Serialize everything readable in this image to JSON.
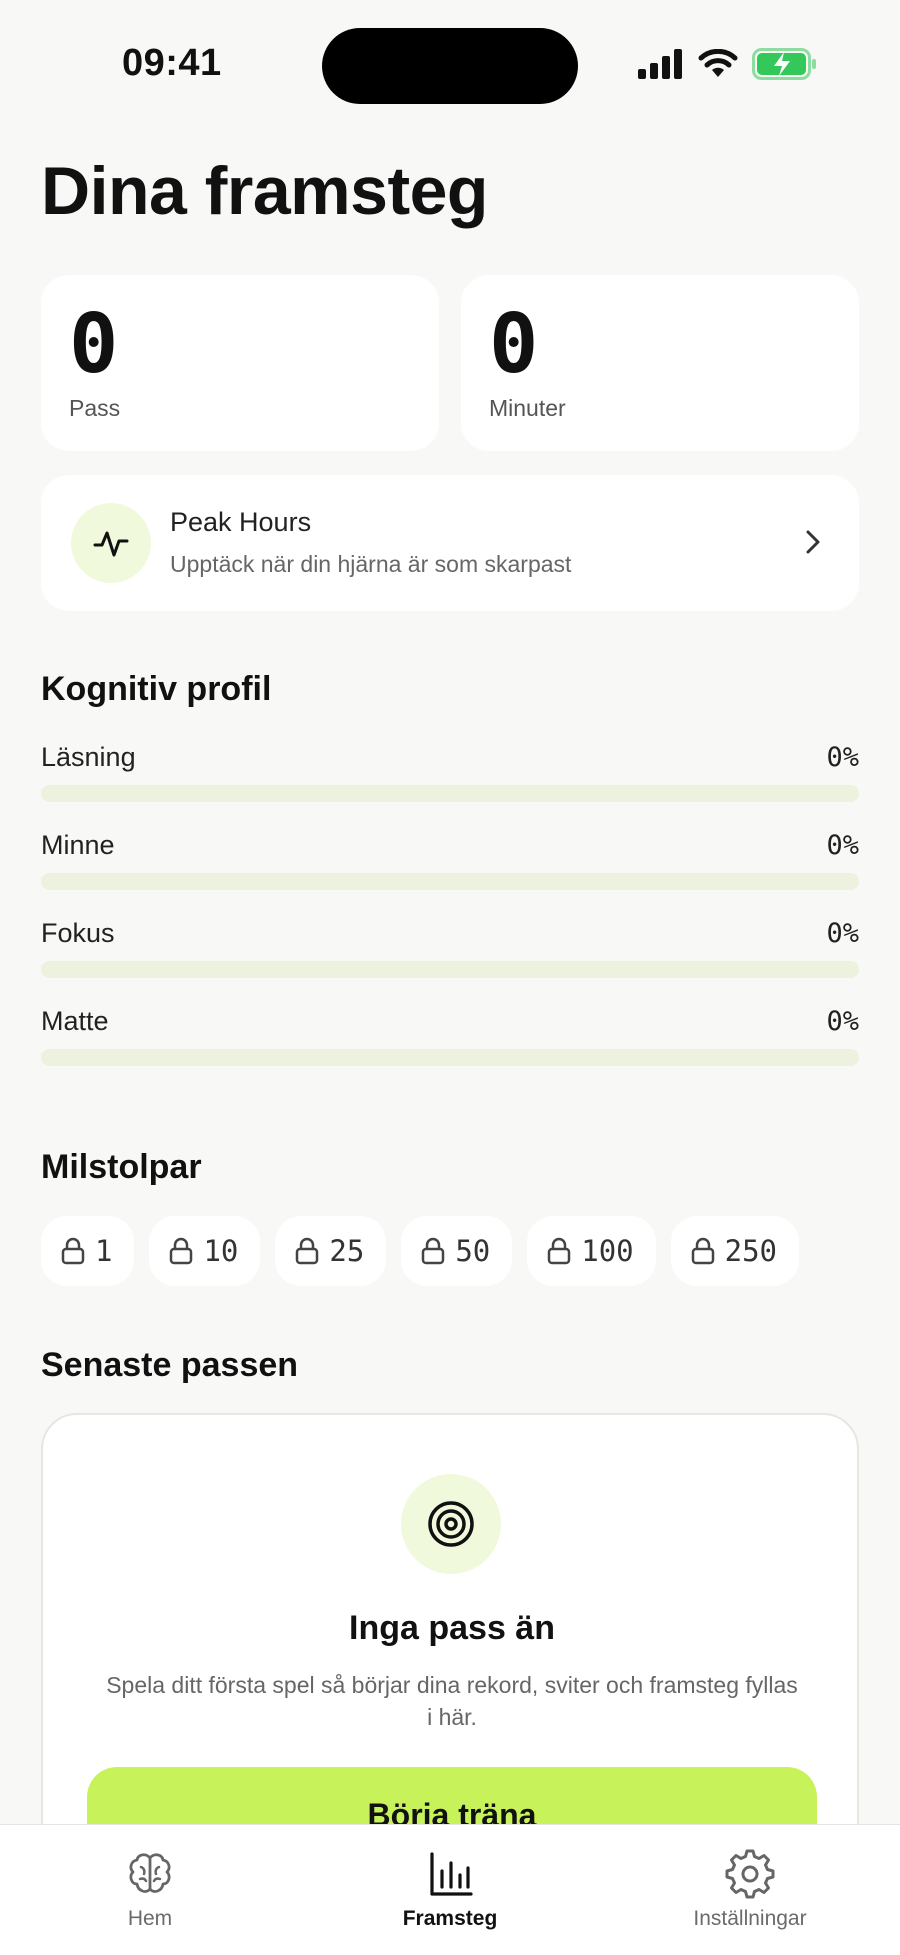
{
  "status_bar": {
    "time": "09:41"
  },
  "page_title": "Dina framsteg",
  "stats": [
    {
      "value": "0",
      "label": "Pass"
    },
    {
      "value": "0",
      "label": "Minuter"
    }
  ],
  "peak_hours": {
    "title": "Peak Hours",
    "subtitle": "Upptäck när din hjärna är som skarpast"
  },
  "cognitive_profile": {
    "title": "Kognitiv profil",
    "items": [
      {
        "label": "Läsning",
        "percent": "0%",
        "value": 0
      },
      {
        "label": "Minne",
        "percent": "0%",
        "value": 0
      },
      {
        "label": "Fokus",
        "percent": "0%",
        "value": 0
      },
      {
        "label": "Matte",
        "percent": "0%",
        "value": 0
      }
    ]
  },
  "milestones": {
    "title": "Milstolpar",
    "items": [
      "1",
      "10",
      "25",
      "50",
      "100",
      "250"
    ]
  },
  "recent": {
    "title": "Senaste passen",
    "empty_title": "Inga pass än",
    "empty_desc": "Spela ditt första spel så börjar dina rekord, sviter och framsteg fyllas i här.",
    "button": "Börja träna"
  },
  "tabs": [
    {
      "label": "Hem",
      "icon": "brain-icon"
    },
    {
      "label": "Framsteg",
      "icon": "bar-chart-icon"
    },
    {
      "label": "Inställningar",
      "icon": "gear-icon"
    }
  ],
  "colors": {
    "accent": "#c8f25a",
    "accent_soft": "#f1f9dc",
    "track": "#edf2df",
    "battery": "#34c759"
  }
}
